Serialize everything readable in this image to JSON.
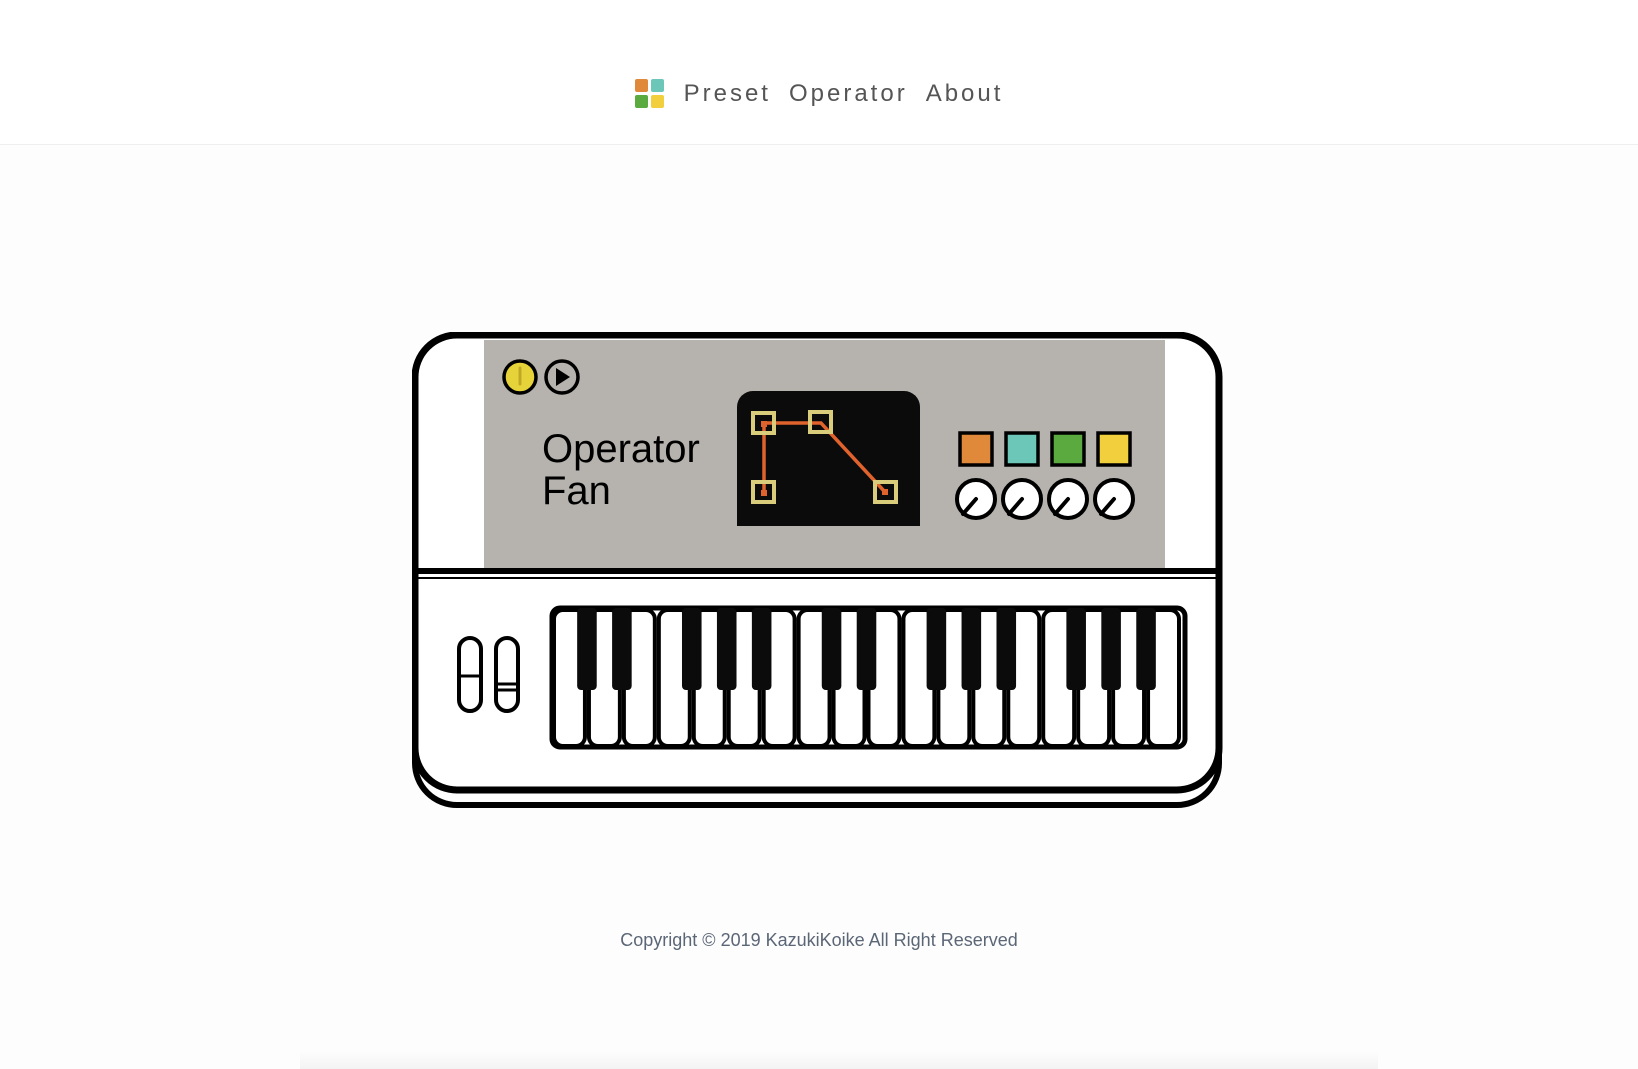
{
  "header": {
    "logo_colors": [
      "#e0893a",
      "#6cc7b8",
      "#5aaa3f",
      "#f2cf3c"
    ],
    "nav": [
      {
        "label": "Preset"
      },
      {
        "label": "Operator"
      },
      {
        "label": "About"
      }
    ]
  },
  "hero": {
    "title_line1": "Operator",
    "title_line2": "Fan",
    "icons": [
      "power-icon",
      "play-icon"
    ],
    "pad_colors": [
      "#e0893a",
      "#6cc7b8",
      "#5aaa3f",
      "#f2cf3c"
    ],
    "envelope_color": "#e0622c",
    "screen_node_color": "#d9cd7c",
    "panel_color": "#b6b2ae",
    "keyboard": {
      "white_keys": 18
    }
  },
  "footer": {
    "copyright": "Copyright © 2019 KazukiKoike All Right Reserved"
  }
}
